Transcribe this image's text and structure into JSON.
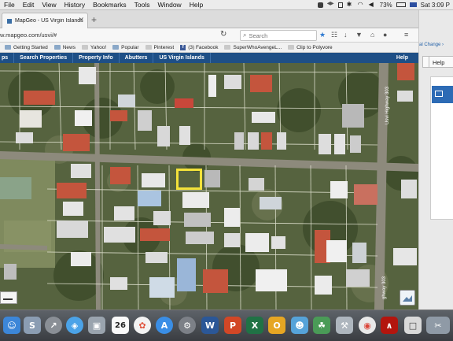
{
  "menubar": {
    "items": [
      "File",
      "Edit",
      "View",
      "History",
      "Bookmarks",
      "Tools",
      "Window",
      "Help"
    ],
    "battery": "73%",
    "clock": "Sat 3:09 P"
  },
  "browser": {
    "tab_title": "MapGeo - US Virgin Islands",
    "url": "w.mapgeo.com/usvi/#",
    "search_placeholder": "Search"
  },
  "bookmarks": [
    "Getting Started",
    "News",
    "Yahoo!",
    "Popular",
    "Pinterest",
    "(3) Facebook",
    "SuperWhoAvengeL...",
    "Clip to Polyvore"
  ],
  "mapgeo_toolbar": {
    "items": [
      "ps",
      "Search Properties",
      "Property Info",
      "Abutters",
      "US Virgin Islands"
    ],
    "help": "Help"
  },
  "map": {
    "road_label_1": "Usvi Highway 303",
    "road_label_2": "ghway 303"
  },
  "right_panel": {
    "link": "al Change ›",
    "help_button": "Help"
  },
  "dock": {
    "calendar_day": "26",
    "apps": [
      "Finder",
      "Spotlight",
      "Rocket",
      "Safari",
      "Preview",
      "Calendar",
      "Photos",
      "App Store",
      "System Preferences",
      "Word",
      "PowerPoint",
      "Excel",
      "Outlook",
      "OneNote",
      "Growl",
      "Script Editor",
      "Chrome",
      "Acrobat",
      "Screenshot",
      "Trash"
    ]
  },
  "colors": {
    "toolbar_blue": "#1e4f86",
    "selection_yellow": "#f3e23a"
  }
}
